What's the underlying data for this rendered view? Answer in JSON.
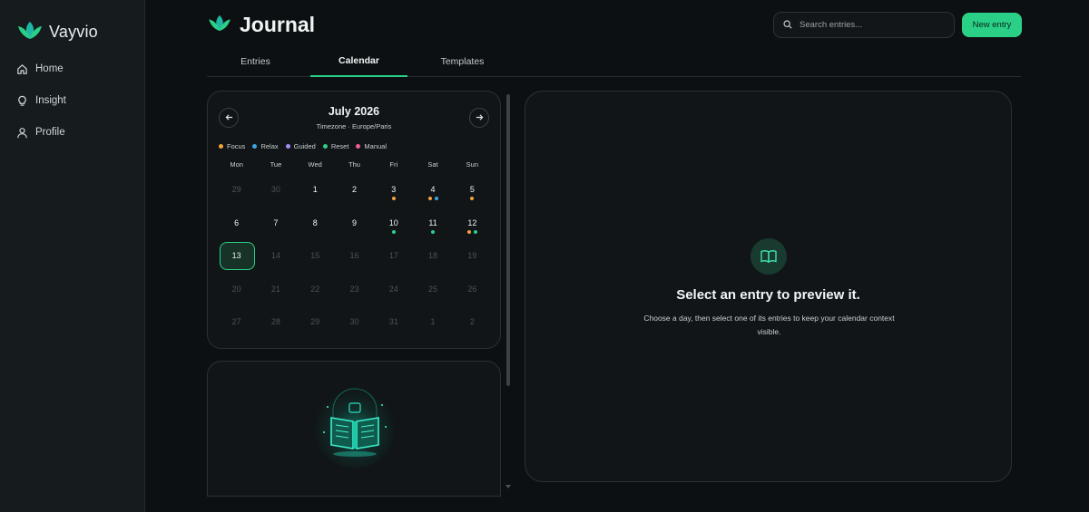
{
  "sidebar": {
    "brand": "Vayvio",
    "items": [
      {
        "label": "Home",
        "icon": "home-icon"
      },
      {
        "label": "Insight",
        "icon": "lightbulb-icon"
      },
      {
        "label": "Profile",
        "icon": "user-icon"
      }
    ]
  },
  "header": {
    "title": "Journal",
    "search_placeholder": "Search entries...",
    "new_entry_label": "New entry"
  },
  "tabs": [
    {
      "label": "Entries",
      "active": false
    },
    {
      "label": "Calendar",
      "active": true
    },
    {
      "label": "Templates",
      "active": false
    }
  ],
  "calendar": {
    "month": "July 2026",
    "timezone": "Timezone · Europe/Paris",
    "legend": [
      {
        "label": "Focus",
        "color": "#f2a33a"
      },
      {
        "label": "Relax",
        "color": "#3ba6e0"
      },
      {
        "label": "Guided",
        "color": "#a78bfa"
      },
      {
        "label": "Reset",
        "color": "#2bd087"
      },
      {
        "label": "Manual",
        "color": "#ec5f98"
      }
    ],
    "weekdays": [
      "Mon",
      "Tue",
      "Wed",
      "Thu",
      "Fri",
      "Sat",
      "Sun"
    ],
    "days": [
      {
        "n": "29",
        "state": "dim",
        "dots": []
      },
      {
        "n": "30",
        "state": "dim",
        "dots": []
      },
      {
        "n": "1",
        "state": "cur",
        "dots": []
      },
      {
        "n": "2",
        "state": "cur",
        "dots": []
      },
      {
        "n": "3",
        "state": "cur",
        "dots": [
          "#f2a33a"
        ]
      },
      {
        "n": "4",
        "state": "cur",
        "dots": [
          "#f2a33a",
          "#3ba6e0"
        ]
      },
      {
        "n": "5",
        "state": "cur",
        "dots": [
          "#f2a33a"
        ]
      },
      {
        "n": "6",
        "state": "cur",
        "dots": []
      },
      {
        "n": "7",
        "state": "cur",
        "dots": []
      },
      {
        "n": "8",
        "state": "cur",
        "dots": []
      },
      {
        "n": "9",
        "state": "cur",
        "dots": []
      },
      {
        "n": "10",
        "state": "cur",
        "dots": [
          "#2bd087"
        ]
      },
      {
        "n": "11",
        "state": "cur",
        "dots": [
          "#2bd087"
        ]
      },
      {
        "n": "12",
        "state": "cur",
        "dots": [
          "#f2a33a",
          "#2bd087"
        ]
      },
      {
        "n": "13",
        "state": "sel",
        "dots": []
      },
      {
        "n": "14",
        "state": "dim",
        "dots": []
      },
      {
        "n": "15",
        "state": "dim",
        "dots": []
      },
      {
        "n": "16",
        "state": "dim",
        "dots": []
      },
      {
        "n": "17",
        "state": "dim",
        "dots": []
      },
      {
        "n": "18",
        "state": "dim",
        "dots": []
      },
      {
        "n": "19",
        "state": "dim",
        "dots": []
      },
      {
        "n": "20",
        "state": "dim",
        "dots": []
      },
      {
        "n": "21",
        "state": "dim",
        "dots": []
      },
      {
        "n": "22",
        "state": "dim",
        "dots": []
      },
      {
        "n": "23",
        "state": "dim",
        "dots": []
      },
      {
        "n": "24",
        "state": "dim",
        "dots": []
      },
      {
        "n": "25",
        "state": "dim",
        "dots": []
      },
      {
        "n": "26",
        "state": "dim",
        "dots": []
      },
      {
        "n": "27",
        "state": "dim",
        "dots": []
      },
      {
        "n": "28",
        "state": "dim",
        "dots": []
      },
      {
        "n": "29",
        "state": "dim",
        "dots": []
      },
      {
        "n": "30",
        "state": "dim",
        "dots": []
      },
      {
        "n": "31",
        "state": "dim",
        "dots": []
      },
      {
        "n": "1",
        "state": "dim",
        "dots": []
      },
      {
        "n": "2",
        "state": "dim",
        "dots": []
      }
    ]
  },
  "preview": {
    "title": "Select an entry to preview it.",
    "description": "Choose a day, then select one of its entries to keep your calendar context visible."
  },
  "colors": {
    "accent": "#2bd087",
    "background": "#0d1012",
    "card": "#111517"
  }
}
